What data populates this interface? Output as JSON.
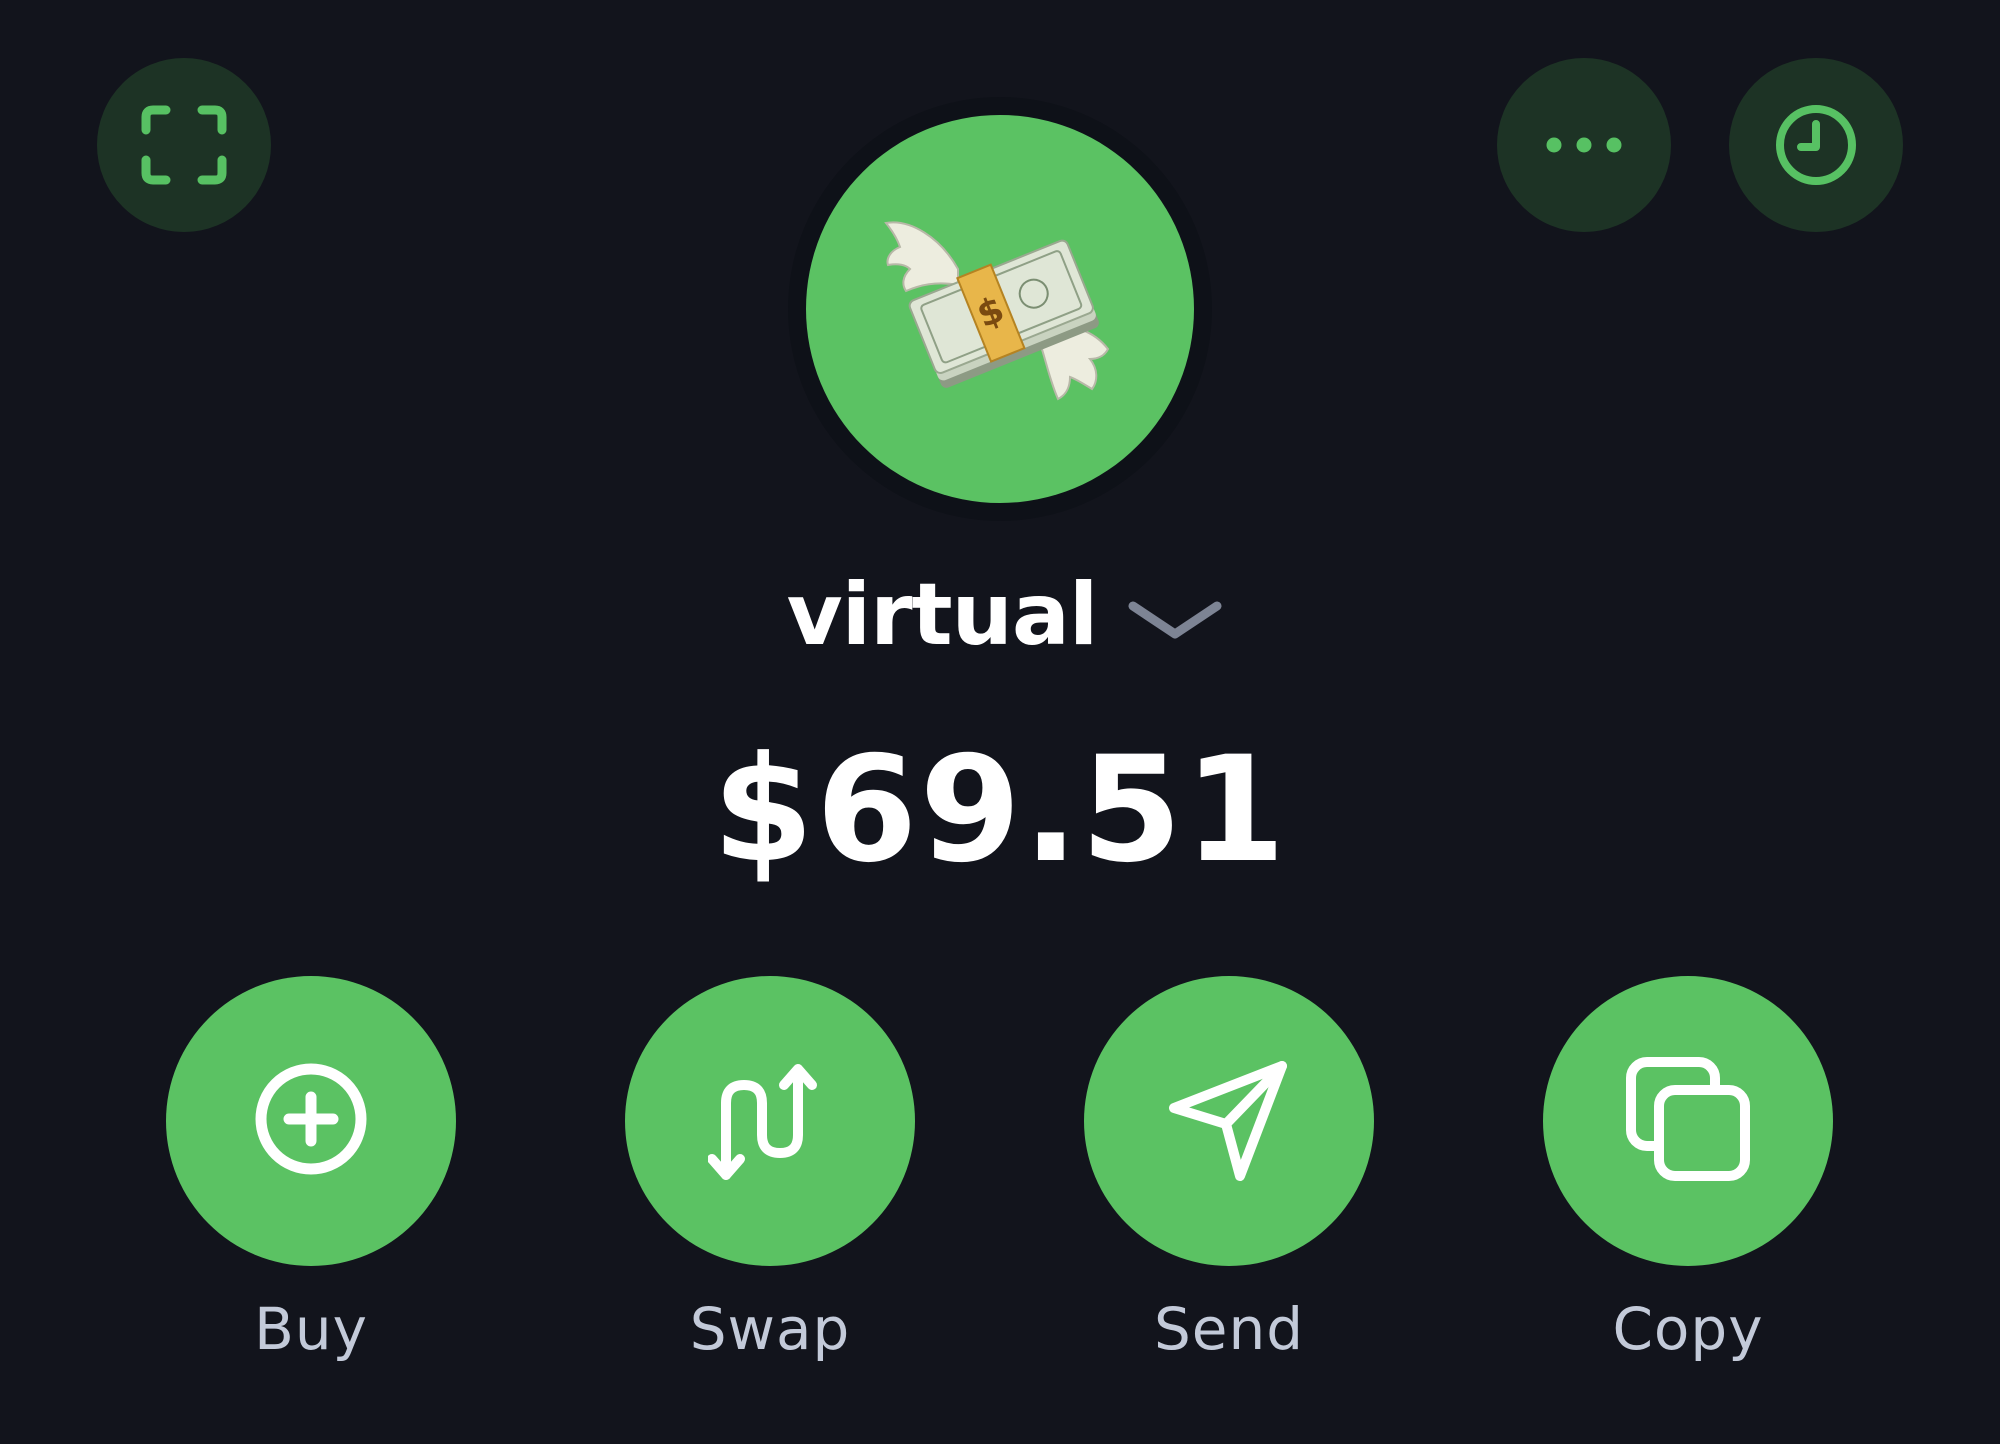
{
  "wallet": {
    "name": "virtual",
    "balance": "$69.51",
    "avatar_icon": "money-with-wings-icon"
  },
  "header": {
    "left_icon": "scan-qr-icon",
    "right_icons": [
      "more-icon",
      "history-icon"
    ]
  },
  "actions": [
    {
      "label": "Buy",
      "icon": "plus-circle-icon"
    },
    {
      "label": "Swap",
      "icon": "swap-arrows-icon"
    },
    {
      "label": "Send",
      "icon": "send-icon"
    },
    {
      "label": "Copy",
      "icon": "copy-icon"
    }
  ],
  "colors": {
    "background": "#12141c",
    "accent": "#5bc263",
    "accent_dark": "#1d3325",
    "label": "#c3cad9",
    "chevron": "#7d8494"
  }
}
